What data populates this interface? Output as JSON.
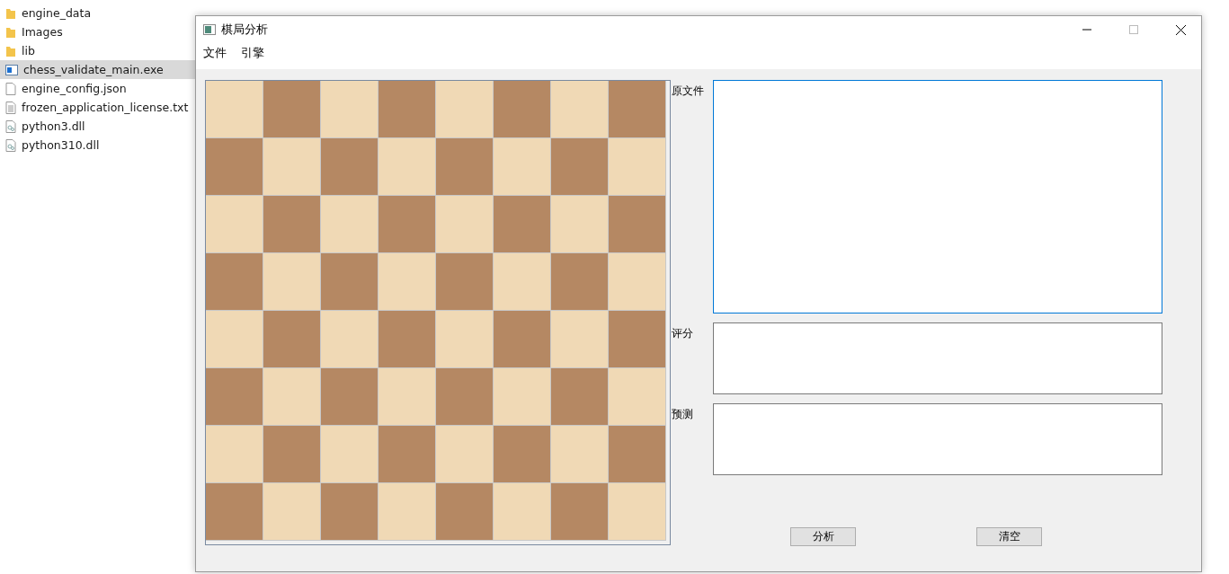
{
  "explorer": {
    "items": [
      {
        "name": "engine_data",
        "kind": "folder",
        "selected": false
      },
      {
        "name": "Images",
        "kind": "folder",
        "selected": false
      },
      {
        "name": "lib",
        "kind": "folder",
        "selected": false
      },
      {
        "name": "chess_validate_main.exe",
        "kind": "exe",
        "selected": true
      },
      {
        "name": "engine_config.json",
        "kind": "file",
        "selected": false
      },
      {
        "name": "frozen_application_license.txt",
        "kind": "text",
        "selected": false
      },
      {
        "name": "python3.dll",
        "kind": "dll",
        "selected": false
      },
      {
        "name": "python310.dll",
        "kind": "dll",
        "selected": false
      }
    ]
  },
  "window": {
    "title": "棋局分析",
    "menu": [
      "文件",
      "引擎"
    ],
    "fields": [
      {
        "label": "原文件",
        "kind": "tall",
        "focused": true
      },
      {
        "label": "评分",
        "kind": "short",
        "focused": false
      },
      {
        "label": "预测",
        "kind": "short",
        "focused": false
      }
    ],
    "buttons": [
      "分析",
      "清空"
    ]
  }
}
